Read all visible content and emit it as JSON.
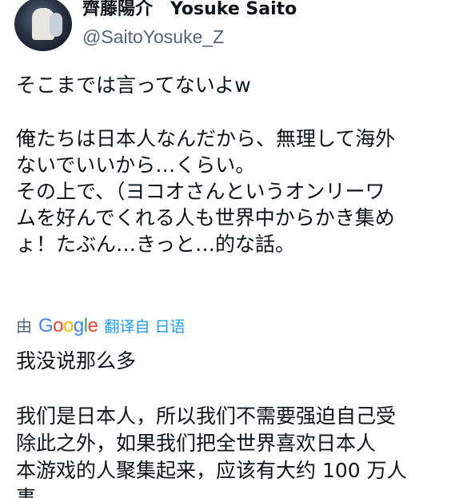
{
  "author": {
    "display_name": "齊藤陽介",
    "display_name_en": "Yosuke Saito",
    "handle": "@SaitoYosuke_Z"
  },
  "tweet": {
    "original_lines": [
      "そこまでは言ってないよw",
      "",
      "俺たちは日本人なんだから、無理して海外",
      "ないでいいから…くらい。",
      "その上で、（ヨコオさんというオンリーワ",
      "ムを好んでくれる人も世界中からかき集め",
      "ょ！たぶん…きっと…的な話。"
    ],
    "translation": {
      "by_label": "由",
      "provider_letters": [
        "G",
        "o",
        "o",
        "g",
        "l",
        "e"
      ],
      "link_label": "翻译自 日语"
    },
    "translated_lines": [
      "我没说那么多",
      "",
      "我们是日本人，所以我们不需要强迫自己受",
      "除此之外，如果我们把全世界喜欢日本人",
      "本游戏的人聚集起来，应该有大约 100 万人",
      "事"
    ]
  },
  "colors": {
    "text_primary": "#0f1419",
    "text_secondary": "#536471",
    "link": "#1d9bf0"
  }
}
